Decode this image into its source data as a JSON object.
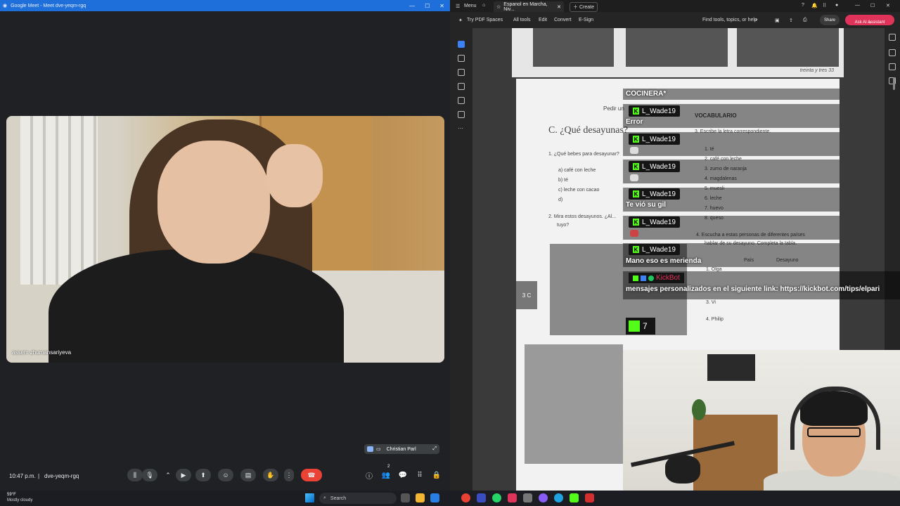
{
  "meet": {
    "window_title": "Google Meet - Meet dve-yeqm-rgq",
    "participant_label": "assem zhumansariyeva",
    "pip_name": "Christian Parl",
    "time": "10:47 p.m.",
    "meeting_code": "dve-yeqm-rgq",
    "participants_count": "2"
  },
  "taskbar": {
    "weather_temp": "59°F",
    "weather_desc": "Mostly cloudy",
    "search_label": "Search"
  },
  "pdf": {
    "menu_label": "Menu",
    "tab_title": "Espanol en Marcha, Niv...",
    "create_label": "Create",
    "try_spaces": "Try PDF Spaces",
    "all_tools": "All tools",
    "edit": "Edit",
    "convert": "Convert",
    "esign": "E-Sign",
    "find_placeholder": "Find tools, topics, or help",
    "share": "Share",
    "ask_assistant": "Ask AI Assistant",
    "page_footer": "treinta y tres  33",
    "section_title": "C. ¿Qué desayunas?",
    "pedir": "Pedir un",
    "vocab": "VOCABULARIO",
    "ex3": "3. Escribe la letra correspondiente.",
    "ex1": "1. ¿Qué bebes para desayunar?",
    "opt_a": "a) café con leche",
    "opt_b": "b) té",
    "opt_c": "c) leche con cacao",
    "opt_d": "d)",
    "ex2": "2. Mira estos desayunos. ¿Al...",
    "ex2b": "tuyo?",
    "list": [
      "1. té",
      "2. café con leche",
      "3. zumo de naranja",
      "4. magdalenas",
      "5. muesli",
      "6. leche",
      "7. huevo",
      "8. queso"
    ],
    "ex4": "4. Escucha a estas personas de diferentes países",
    "ex4b": "hablar de su desayuno. Completa la tabla.",
    "col_pais": "País",
    "col_desayuno": "Desayuno",
    "row1": "1. Olga",
    "row3": "3. Vi",
    "row4": "4. Philip",
    "tab3c": "3 C"
  },
  "chat": {
    "messages": [
      {
        "user": "",
        "text": "COCINERA*"
      },
      {
        "user": "L_Wade19",
        "text": "Error"
      },
      {
        "user": "L_Wade19",
        "text": ""
      },
      {
        "user": "L_Wade19",
        "text": ""
      },
      {
        "user": "L_Wade19",
        "text": "Te vió su gil"
      },
      {
        "user": "L_Wade19",
        "text": ""
      },
      {
        "user": "L_Wade19",
        "text": "Mano eso es merienda"
      }
    ],
    "bot_name": "KickBot",
    "bot_text": "mensajes personalizados en el siguiente link: https://kickbot.com/tips/elpari",
    "kick_count": "7"
  },
  "colors": {
    "kick_green": "#53fc18",
    "meet_bar": "#202124",
    "hangup_red": "#ea4335",
    "assistant_pink": "#e0335a"
  }
}
